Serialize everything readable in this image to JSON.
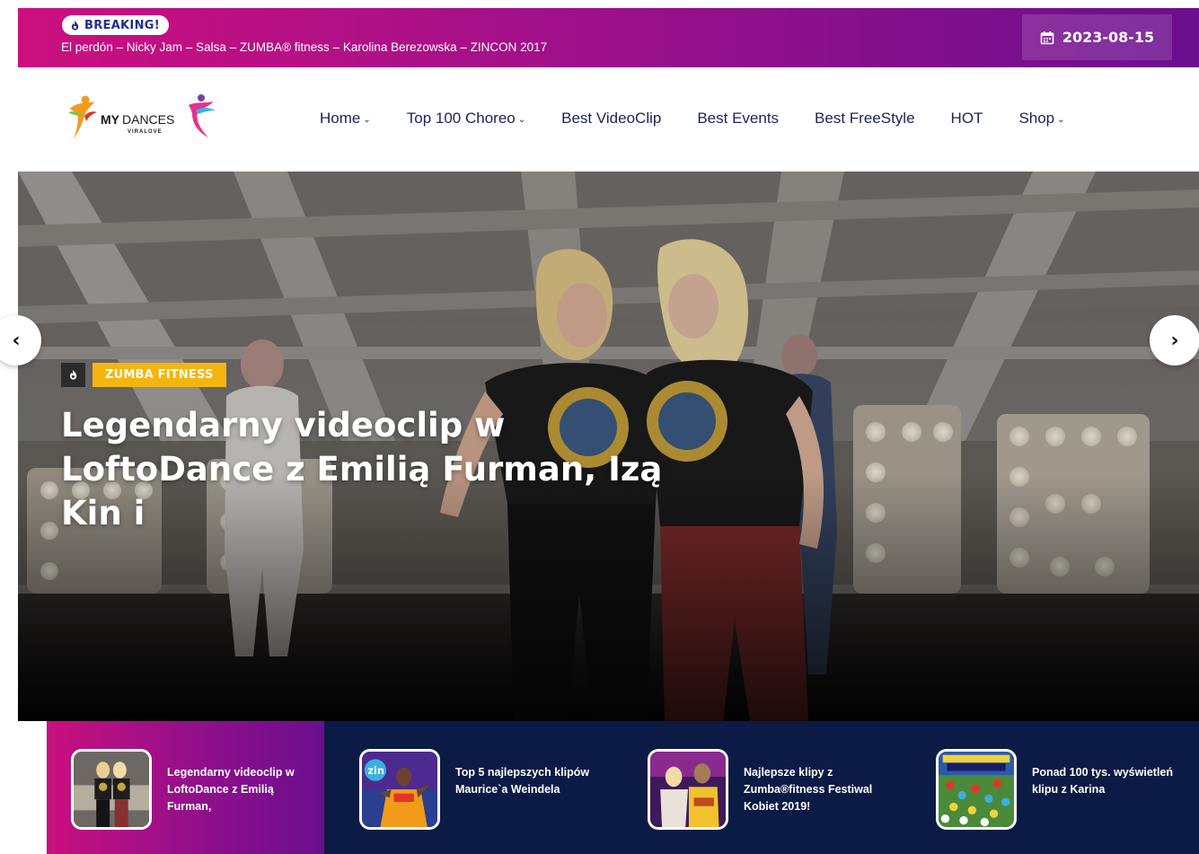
{
  "topbar": {
    "breaking_label": "BREAKING!",
    "breaking_text": "El perdón – Nicky Jam – Salsa – ZUMBA® fitness – Karolina Berezowska – ZINCON 2017",
    "date": "2023-08-15",
    "colors": {
      "gradient_start": "#cc0f7e",
      "gradient_end": "#6a0f8e"
    }
  },
  "header": {
    "logo": {
      "main": "MYDANCES",
      "sub": "VIRALOVE"
    },
    "nav": [
      {
        "label": "Home",
        "dropdown": true
      },
      {
        "label": "Top 100 Choreo",
        "dropdown": true
      },
      {
        "label": "Best VideoClip",
        "dropdown": false
      },
      {
        "label": "Best Events",
        "dropdown": false
      },
      {
        "label": "Best FreeStyle",
        "dropdown": false
      },
      {
        "label": "HOT",
        "dropdown": false
      },
      {
        "label": "Shop",
        "dropdown": true
      }
    ]
  },
  "hero": {
    "category": "ZUMBA FITNESS",
    "title": "Legendarny videoclip w LoftoDance z Emilią Furman, Izą Kin i",
    "prev_icon": "chevron-left-icon",
    "next_icon": "chevron-right-icon",
    "colors": {
      "category_bg": "#f5b50f"
    }
  },
  "strip": {
    "items": [
      {
        "title": "Legendarny videoclip w LoftoDance z Emilią Furman,",
        "active": true
      },
      {
        "title": "Top 5 najlepszych klipów Maurice`a Weindela",
        "active": false
      },
      {
        "title": "Najlepsze klipy z Zumba®fitness Festiwal Kobiet 2019!",
        "active": false
      },
      {
        "title": "Ponad 100 tys. wyświetleń klipu z Karina",
        "active": false
      }
    ],
    "colors": {
      "background": "#0b1b45"
    }
  }
}
